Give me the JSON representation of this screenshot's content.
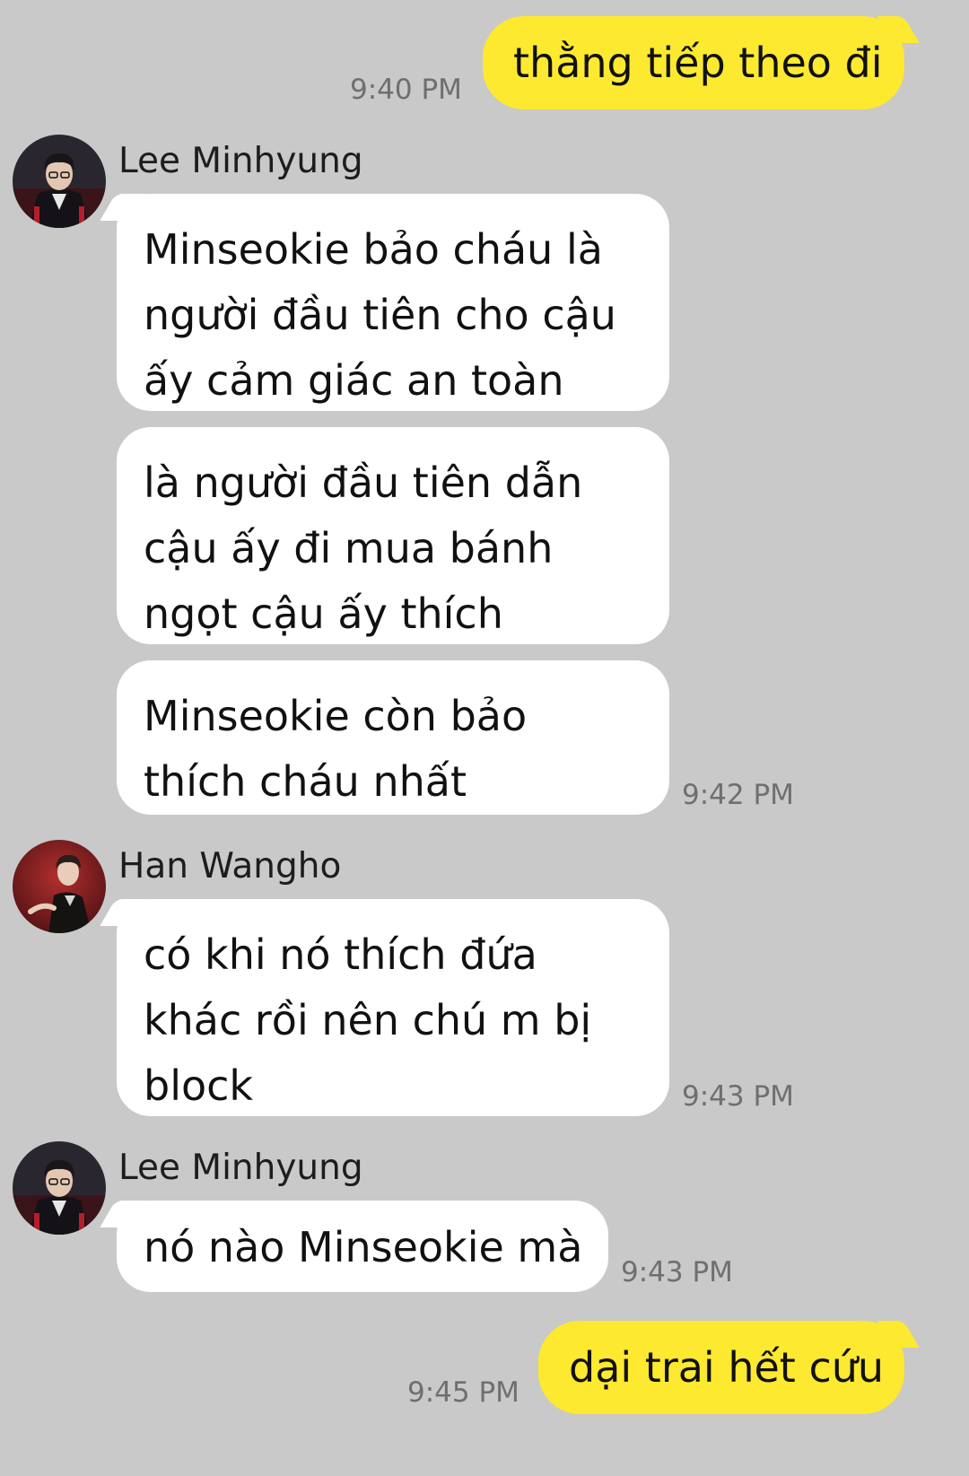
{
  "messages": {
    "out1": {
      "text": "thằng tiếp theo đi",
      "time": "9:40 PM"
    },
    "group1": {
      "sender": "Lee Minhyung",
      "bubble1": [
        "Minseokie bảo cháu là",
        "người đầu tiên cho cậu",
        "ấy cảm giác an toàn"
      ],
      "bubble2": [
        "là người đầu tiên dẫn",
        "cậu ấy đi mua bánh",
        "ngọt cậu ấy thích"
      ],
      "bubble3": [
        "Minseokie còn bảo",
        "thích cháu nhất"
      ],
      "time": "9:42 PM"
    },
    "group2": {
      "sender": "Han Wangho",
      "bubble1": [
        "có khi nó thích đứa",
        "khác rồi nên chú m bị",
        "block"
      ],
      "time": "9:43 PM"
    },
    "group3": {
      "sender": "Lee Minhyung",
      "bubble1": [
        "nó nào Minseokie mà"
      ],
      "time": "9:43 PM"
    },
    "out2": {
      "text": "dại trai hết cứu",
      "time": "9:45 PM"
    }
  },
  "colors": {
    "background": "#c9c9c9",
    "outgoing_bubble": "#fde92f",
    "incoming_bubble": "#ffffff",
    "timestamp": "#6f6f6f"
  },
  "icons": {
    "avatar_lee": "profile-photo-man-dark-jacket",
    "avatar_han": "profile-photo-man-red-background"
  }
}
